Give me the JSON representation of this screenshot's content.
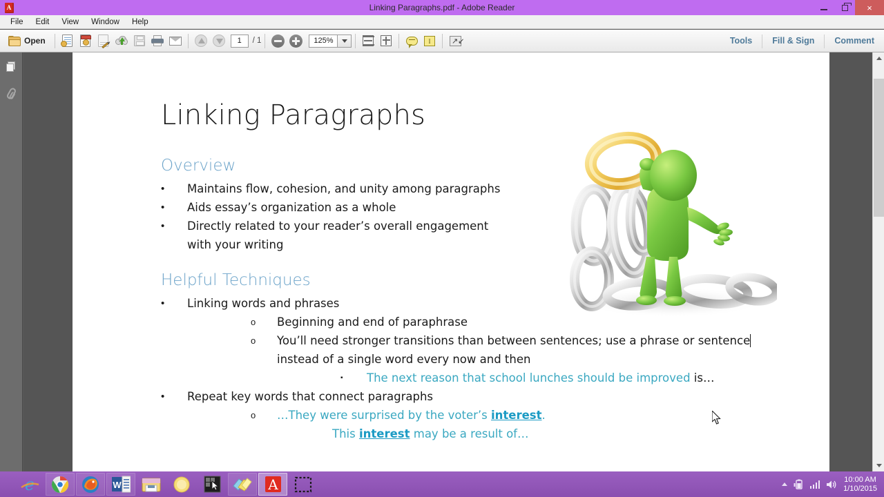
{
  "window": {
    "title": "Linking Paragraphs.pdf - Adobe Reader",
    "app_icon": "pdf-document-icon",
    "minimize_label": "Minimize",
    "restore_label": "Restore",
    "close_label": "×"
  },
  "menubar": {
    "items": [
      {
        "label": "File"
      },
      {
        "label": "Edit"
      },
      {
        "label": "View"
      },
      {
        "label": "Window"
      },
      {
        "label": "Help"
      }
    ]
  },
  "toolbar": {
    "open_label": "Open",
    "open_icon": "folder-open-icon",
    "buttons": [
      {
        "name": "create-pdf-button",
        "icon": "page-with-hand-icon"
      },
      {
        "name": "export-pdf-button",
        "icon": "page-red-header-icon"
      },
      {
        "name": "edit-pdf-button",
        "icon": "page-pencil-icon"
      },
      {
        "name": "upload-cloud-button",
        "icon": "cloud-upload-icon"
      },
      {
        "name": "save-button",
        "icon": "floppy-save-icon"
      },
      {
        "name": "print-button",
        "icon": "printer-icon"
      },
      {
        "name": "email-button",
        "icon": "envelope-icon"
      }
    ],
    "nav": {
      "previous_page_icon": "arrow-up-circle-icon",
      "next_page_icon": "arrow-down-circle-icon",
      "page_number": "1",
      "page_total": "/ 1"
    },
    "zoom": {
      "zoom_out_icon": "minus-circle-icon",
      "zoom_in_icon": "plus-circle-icon",
      "level": "125%",
      "dropdown_icon": "chevron-down-icon"
    },
    "view_buttons": [
      {
        "name": "fit-width-button",
        "icon": "fit-width-icon"
      },
      {
        "name": "fit-page-button",
        "icon": "fit-page-icon"
      }
    ],
    "comment_buttons": [
      {
        "name": "sticky-note-button",
        "icon": "comment-bubble-icon"
      },
      {
        "name": "highlight-text-button",
        "icon": "text-highlight-icon"
      }
    ],
    "fullscreen": {
      "name": "read-mode-button",
      "icon": "expand-arrows-icon"
    },
    "right_panels": [
      {
        "label": "Tools"
      },
      {
        "label": "Fill & Sign"
      },
      {
        "label": "Comment"
      }
    ]
  },
  "navpane": {
    "items": [
      {
        "name": "page-thumbnails-button",
        "icon": "page-thumbnails-icon"
      },
      {
        "name": "attachments-button",
        "icon": "paperclip-icon"
      }
    ]
  },
  "document": {
    "title": "Linking Paragraphs",
    "sections": [
      {
        "heading": "Overview",
        "bullets": [
          {
            "level": 1,
            "marker": "•",
            "text": "Maintains flow, cohesion, and unity among paragraphs",
            "color": "dark"
          },
          {
            "level": 1,
            "marker": "•",
            "text": "Aids essay’s organization as a whole",
            "color": "dark"
          },
          {
            "level": 1,
            "marker": "•",
            "text": "Directly related to your reader’s overall engagement",
            "color": "dark"
          },
          {
            "level": 1,
            "marker": "",
            "text": "with your writing",
            "color": "dark",
            "continuation": true
          }
        ]
      },
      {
        "heading": "Helpful Techniques",
        "bullets": [
          {
            "level": 1,
            "marker": "•",
            "text": "Linking words and phrases",
            "color": "dark"
          },
          {
            "level": 2,
            "marker": "o",
            "text": "Beginning and end of paraphrase",
            "color": "dark"
          },
          {
            "level": 2,
            "marker": "o",
            "text": "You’ll need stronger transitions than between sentences; use a phrase or sentence",
            "color": "dark",
            "caret": true
          },
          {
            "level": 2,
            "marker": "",
            "text": "instead of a single word every now and then",
            "color": "dark",
            "continuation": true
          },
          {
            "level": 3,
            "marker": "▪",
            "text": "The next reason that school lunches should be improved",
            "trailing": " is…",
            "color": "teal"
          },
          {
            "level": 1,
            "marker": "•",
            "text": "Repeat key words that connect paragraphs",
            "color": "dark"
          },
          {
            "level": 2,
            "marker": "o",
            "text": "…They were surprised by the voter’s ",
            "bold_underline": "interest",
            "trailing": ".",
            "color": "teal"
          },
          {
            "level": 2,
            "marker": "",
            "text": "This ",
            "bold_underline": "interest",
            "trailing": " may be a result of…",
            "color": "teal",
            "continuation": true,
            "indent_extra": true
          }
        ]
      }
    ],
    "image": {
      "name": "chain-links-mascot-image",
      "alt": "Green 3D mascot figure holding a gold chain link joined to silver chain links"
    }
  },
  "scrollbar": {
    "up_icon": "chevron-up-icon",
    "down_icon": "chevron-down-icon"
  },
  "taskbar": {
    "apps": [
      {
        "name": "taskbar-internet-explorer",
        "icon": "internet-explorer-icon",
        "active": false,
        "bare": true
      },
      {
        "name": "taskbar-google-chrome",
        "icon": "chrome-icon",
        "active": false
      },
      {
        "name": "taskbar-firefox",
        "icon": "firefox-icon",
        "active": false
      },
      {
        "name": "taskbar-word",
        "icon": "word-icon",
        "active": false
      },
      {
        "name": "taskbar-file-explorer",
        "icon": "file-explorer-icon",
        "active": false,
        "bare": true
      },
      {
        "name": "taskbar-media",
        "icon": "yellow-circle-icon",
        "active": false,
        "bare": true
      },
      {
        "name": "taskbar-screen-capture",
        "icon": "cursor-capture-icon",
        "active": false,
        "bare": true
      },
      {
        "name": "taskbar-sticky-notes",
        "icon": "sticky-notes-icon",
        "active": false
      },
      {
        "name": "taskbar-adobe-reader",
        "icon": "adobe-reader-icon",
        "active": true
      },
      {
        "name": "taskbar-snipping-tool",
        "icon": "dashed-selection-icon",
        "active": false
      }
    ],
    "tray": {
      "overflow_icon": "chevron-up-icon",
      "battery_icon": "battery-icon",
      "network_icon": "signal-bars-icon",
      "volume_icon": "speaker-icon",
      "time": "10:00 AM",
      "date": "1/10/2015"
    }
  },
  "colors": {
    "titlebar": "#bf6cf0",
    "taskbar": "#9a5fc0",
    "heading_blue": "#6ba3c9",
    "body_teal": "#3aa8c1",
    "link_blue": "#1c9bc4",
    "viewer_bg": "#555555",
    "close_button": "#cd5c5c"
  }
}
